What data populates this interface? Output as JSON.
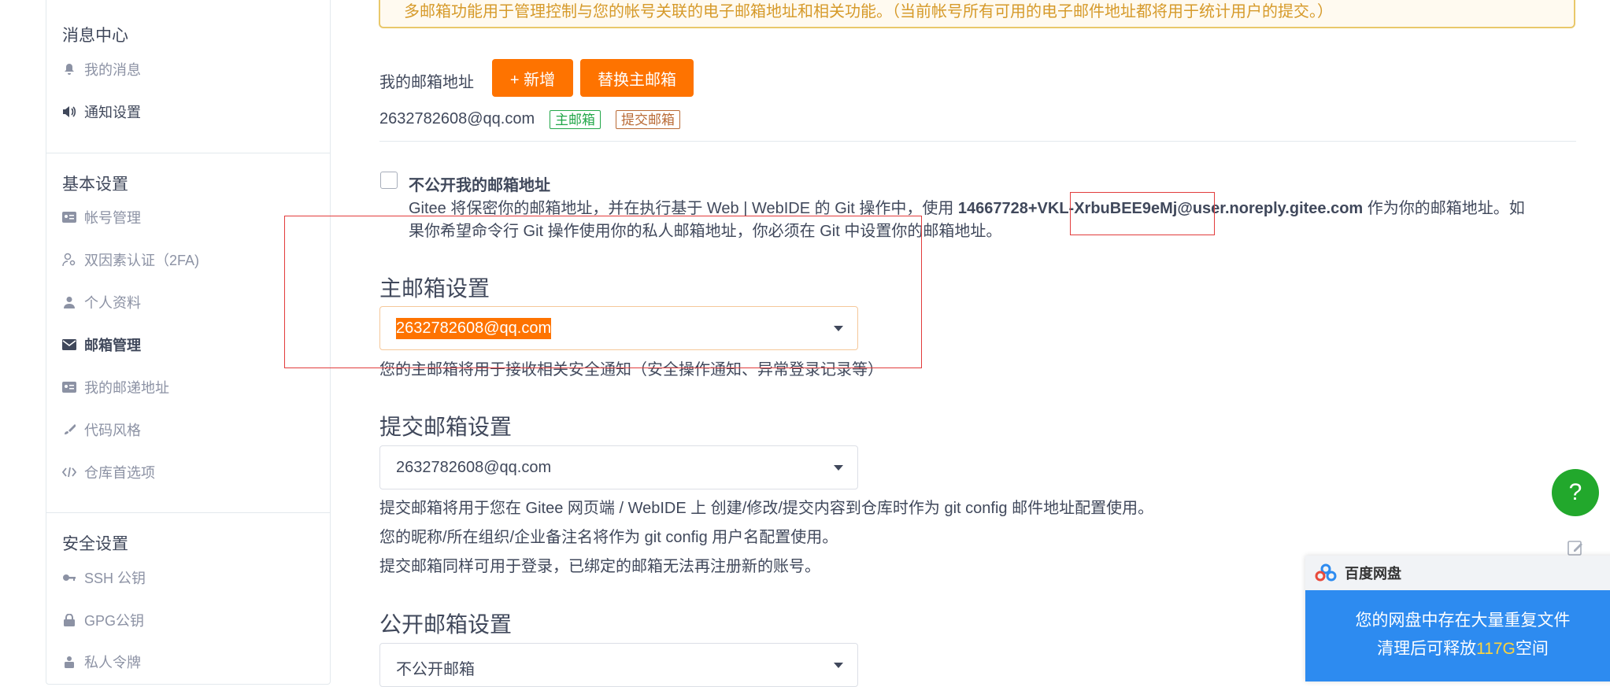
{
  "sidebar": {
    "messages": {
      "title": "消息中心",
      "items": [
        {
          "label": "我的消息",
          "icon": "bell-icon"
        },
        {
          "label": "通知设置",
          "icon": "volume-icon"
        }
      ]
    },
    "basic": {
      "title": "基本设置",
      "items": [
        {
          "label": "帐号管理",
          "icon": "id-card-icon"
        },
        {
          "label": "双因素认证（2FA)",
          "icon": "user-key-icon"
        },
        {
          "label": "个人资料",
          "icon": "user-icon"
        },
        {
          "label": "邮箱管理",
          "icon": "envelope-icon"
        },
        {
          "label": "我的邮递地址",
          "icon": "address-card-icon"
        },
        {
          "label": "代码风格",
          "icon": "brush-icon"
        },
        {
          "label": "仓库首选项",
          "icon": "code-icon"
        }
      ]
    },
    "security": {
      "title": "安全设置",
      "items": [
        {
          "label": "SSH 公钥",
          "icon": "key-icon"
        },
        {
          "label": "GPG公钥",
          "icon": "lock-icon"
        },
        {
          "label": "私人令牌",
          "icon": "token-icon"
        }
      ]
    }
  },
  "main": {
    "notice": "多邮箱功能用于管理控制与您的帐号关联的电子邮箱地址和相关功能。（当前帐号所有可用的电子邮件地址都将用于统计用户的提交。）",
    "my_emails_label": "我的邮箱地址",
    "add_button": "+ 新增",
    "replace_button": "替换主邮箱",
    "email": "2632782608@qq.com",
    "tag_primary": "主邮箱",
    "tag_commit": "提交邮箱",
    "private": {
      "label": "不公开我的邮箱地址",
      "desc_part1": "Gitee 将保密你的邮箱地址，并在执行基于 Web | WebIDE 的 Git 操作中，使用 ",
      "noreply": "14667728+VKL-XrbuBEE9eMj@user.noreply.gitee.com",
      "desc_part2": " 作为你的邮箱地址。如",
      "desc_line2": "果你希望命令行 Git 操作使用你的私人邮箱地址，你必须在 Git 中设置你的邮箱地址。"
    },
    "primary_section": {
      "title": "主邮箱设置",
      "value": "2632782608@qq.com",
      "help": "您的主邮箱将用于接收相关安全通知（安全操作通知、异常登录记录等）"
    },
    "commit_section": {
      "title": "提交邮箱设置",
      "value": "2632782608@qq.com",
      "help1": "提交邮箱将用于您在 Gitee 网页端 / WebIDE 上 创建/修改/提交内容到仓库时作为 git config 邮件地址配置使用。",
      "help2": "您的昵称/所在组织/企业备注名将作为 git config 用户名配置使用。",
      "help3": "提交邮箱同样可用于登录，已绑定的邮箱无法再注册新的账号。"
    },
    "public_section": {
      "title": "公开邮箱设置",
      "value": "不公开邮箱"
    }
  },
  "floating": {
    "help": "?",
    "baidu_title": "百度网盘",
    "baidu_line1": "您的网盘中存在大量重复文件",
    "baidu_line2a": "清理后可释放",
    "baidu_line2b": "117G",
    "baidu_line2c": "空间"
  },
  "colors": {
    "accent": "#fe7300",
    "green": "#22a749",
    "brown": "#b96a35",
    "annotation": "#e23c3c"
  }
}
